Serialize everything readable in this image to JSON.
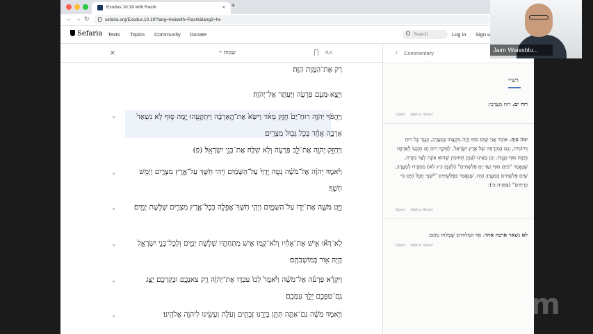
{
  "browser": {
    "tab_title": "Exodus 10:19 with Rashi",
    "url": "sefaria.org/Exodus.10.19?lang=he&with=Rashi&lang2=he"
  },
  "header": {
    "logo": "Sefaria",
    "nav": [
      "Texts",
      "Topics",
      "Community",
      "Donate"
    ],
    "search_placeholder": "Search",
    "login": "Log in",
    "signup": "Sign u"
  },
  "text_panel": {
    "ref": "שמות י׳",
    "font_toggle": "Aא",
    "verses": [
      {
        "num": "",
        "text": "רַק אֶת־הַמָּ֖וֶת הַזֶּֽה׃"
      },
      {
        "num": "יח",
        "text": "וַיֵּצֵ֖א מֵעִ֣ם פַּרְעֹ֑ה וַיֶּעְתַּ֖ר אֶל־יְהֹוָֽה׃"
      },
      {
        "num": "יט",
        "text": "וַיַּהֲפֹ֨ךְ יְהֹוָ֤ה רֽוּחַ־יָם֙ חָזָ֣ק מְאֹ֔ד וַיִּשָּׂא֙ אֶת־הָ֣אַרְבֶּ֔ה וַיִּתְקָעֵ֖הוּ יָ֣מָּה סּ֑וּף לֹ֤א נִשְׁאַר֙ אַרְבֶּ֣ה אֶחָ֔ד בְּכֹ֖ל גְּב֥וּל מִצְרָֽיִם׃"
      },
      {
        "num": "כ",
        "text": "וַיְחַזֵּ֥ק יְהֹוָ֖ה אֶת־לֵ֣ב פַּרְעֹ֑ה וְלֹ֥א שִׁלַּ֖ח אֶת־בְּנֵ֥י יִשְׂרָאֵֽל׃ (פ)"
      },
      {
        "num": "כא",
        "text": "וַיֹּ֨אמֶר יְהֹוָ֜ה אֶל־מֹשֶׁ֗ה נְטֵ֤ה יָֽדְךָ֙ עַל־הַשָּׁמַ֔יִם וִ֥יהִי חֹ֖שֶׁךְ עַל־אֶ֣רֶץ מִצְרָ֑יִם וְיָמֵ֖שׁ חֹֽשֶׁךְ׃"
      },
      {
        "num": "כב",
        "text": "וַיֵּ֥ט מֹשֶׁ֛ה אֶת־יָד֖וֹ עַל־הַשָּׁמָ֑יִם וַיְהִ֧י חֹֽשֶׁךְ־אֲפֵלָ֛ה בְּכׇל־אֶ֥רֶץ מִצְרַ֖יִם שְׁלֹ֥שֶׁת יָמִֽים׃"
      },
      {
        "num": "כג",
        "text": "לֹֽא־רָא֞וּ אִ֣ישׁ אֶת־אָחִ֗יו וְלֹא־קָ֛מוּ אִ֥ישׁ מִתַּחְתָּ֖יו שְׁלֹ֣שֶׁת יָמִ֑ים וּֽלְכׇל־בְּנֵ֧י יִשְׂרָאֵ֛ל הָ֥יָה א֖וֹר בְּמוֹשְׁבֹתָֽם׃"
      },
      {
        "num": "כד",
        "text": "וַיִּקְרָ֨א פַרְעֹ֜ה אֶל־מֹשֶׁ֗ה וַיֹּ֙אמֶר֙ לְכוּ֙ עִבְד֣וּ אֶת־יְהֹוָ֔ה רַ֛ק צֹאנְכֶ֥ם וּבְקַרְכֶ֖ם יֻצָּ֑ג גַּֽם־טַפְּכֶ֖ם יֵלֵ֥ךְ עִמָּכֶֽם׃"
      },
      {
        "num": "כה",
        "text": "וַיֹּ֣אמֶר מֹשֶׁ֔ה גַּם־אַתָּ֛ה תִּתֵּ֥ן בְּיָדֵ֖נוּ זְבָחִ֣ים וְעֹלֹ֑ת וְעָשִׂ֖ינוּ לַיהֹוָ֥ה אֱלֹהֵֽינוּ׃"
      }
    ]
  },
  "commentary": {
    "back_label": "Commentary",
    "commentator": "רש״י",
    "open_label": "Open",
    "add_label": "Add to Sheet",
    "items": [
      {
        "head": "רוח ים.",
        "body": " רוּחַ מַעֲרָבִי:"
      },
      {
        "head": "ימה סוף.",
        "body": " אוֹמֵר אֲנִי שֶׁיַּם סוּף הָיָה מְקְצָתוֹ בְּמַעֲרָב, כְּנֶגֶד כָּל רוּחַ דְּרוֹמִית, וְגַם בְּמִזְרָחָהּ שֶׁל אֶרֶץ יִשְׂרָאֵל, לְפִיכָךְ רוּחַ יָם תְּקָעוֹ לְאַרְבֶּה בְּיַמָּהּ סוּף כְּנֶגְדּוֹ. וְכֵן מָצִינוּ לְעִנְיַן תְּחוּמִין שֶׁהוּא פּוֹנֶה לְצַד מִזְרָח, שֶׁנֶּאֱמַר \"מִיַּם סוּף וְעַד יָם פְּלִשְׁתִּים\" (לְקַמָּן כ״ג לא) מִמִּזְרָח לְמַעֲרָב, שֶׁיַּם פְּלִשְׁתִּים בְּמַעֲרָב הָיָה, שֶׁנֶּאֱמַר בַּפְּלִשְׁתִּים \"יֹשְׁבֵי חֶבֶל הַיָּם גּוֹי כְּרֵתִים\" (צפניה ב׳):"
      },
      {
        "head": "לא נשאר ארבה אחד.",
        "body": " אַף הַמְּלוּחִים שֶׁמָּלְחוּ מֵהֶם:"
      }
    ]
  },
  "zoom": {
    "participant_name": "Jaim Waissblu...",
    "watermark": "zoom"
  }
}
